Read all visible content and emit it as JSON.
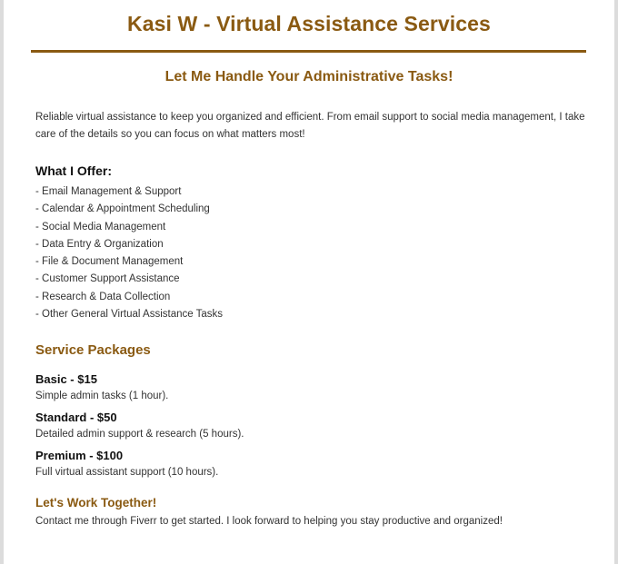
{
  "header": {
    "title": "Kasi W - Virtual Assistance Services",
    "subtitle": "Let Me Handle Your Administrative Tasks!"
  },
  "intro": "Reliable virtual assistance to keep you organized and efficient. From email support to social media management, I take care of the details so you can focus on what matters most!",
  "offer": {
    "heading": "What I Offer:",
    "items": [
      "- Email Management & Support",
      "- Calendar & Appointment Scheduling",
      "- Social Media Management",
      "- Data Entry & Organization",
      "- File & Document Management",
      "- Customer Support Assistance",
      "- Research & Data Collection",
      "- Other General Virtual Assistance Tasks"
    ]
  },
  "packages": {
    "heading": "Service Packages",
    "items": [
      {
        "name": "Basic - $15",
        "description": "Simple admin tasks (1 hour)."
      },
      {
        "name": "Standard - $50",
        "description": "Detailed admin support & research (5 hours)."
      },
      {
        "name": "Premium - $100",
        "description": "Full virtual assistant support (10 hours)."
      }
    ]
  },
  "closing": {
    "heading": "Let's Work Together!",
    "text": "Contact me through Fiverr to get started. I look forward to helping you stay productive and organized!"
  },
  "colors": {
    "accent": "#8a5a12",
    "text": "#333333",
    "heading_text": "#111111",
    "frame": "#dcdcdc"
  }
}
